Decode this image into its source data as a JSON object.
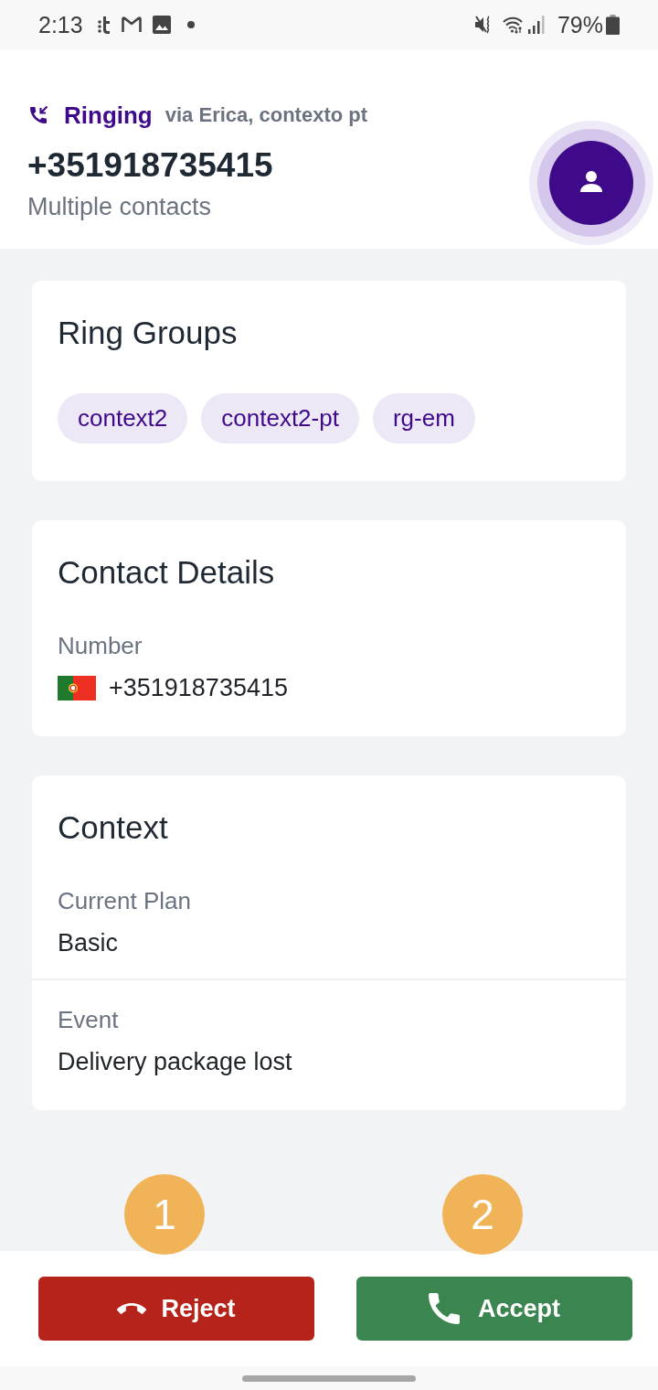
{
  "status_bar": {
    "time": "2:13",
    "battery": "79%"
  },
  "call": {
    "status": "Ringing",
    "via": "via Erica, contexto pt",
    "number": "+351918735415",
    "subtitle": "Multiple contacts"
  },
  "ring_groups": {
    "title": "Ring Groups",
    "chips": [
      "context2",
      "context2-pt",
      "rg-em"
    ]
  },
  "contact_details": {
    "title": "Contact Details",
    "fields": [
      {
        "kind": "phone",
        "label": "Number",
        "value": "+351918735415"
      }
    ]
  },
  "context": {
    "title": "Context",
    "fields": [
      {
        "kind": "text",
        "label": "Current Plan",
        "value": "Basic"
      },
      {
        "kind": "text",
        "label": "Event",
        "value": "Delivery package lost"
      }
    ]
  },
  "actions": [
    {
      "kind": "reject",
      "label": "Reject",
      "step": "1"
    },
    {
      "kind": "accept",
      "label": "Accept",
      "step": "2"
    }
  ]
}
